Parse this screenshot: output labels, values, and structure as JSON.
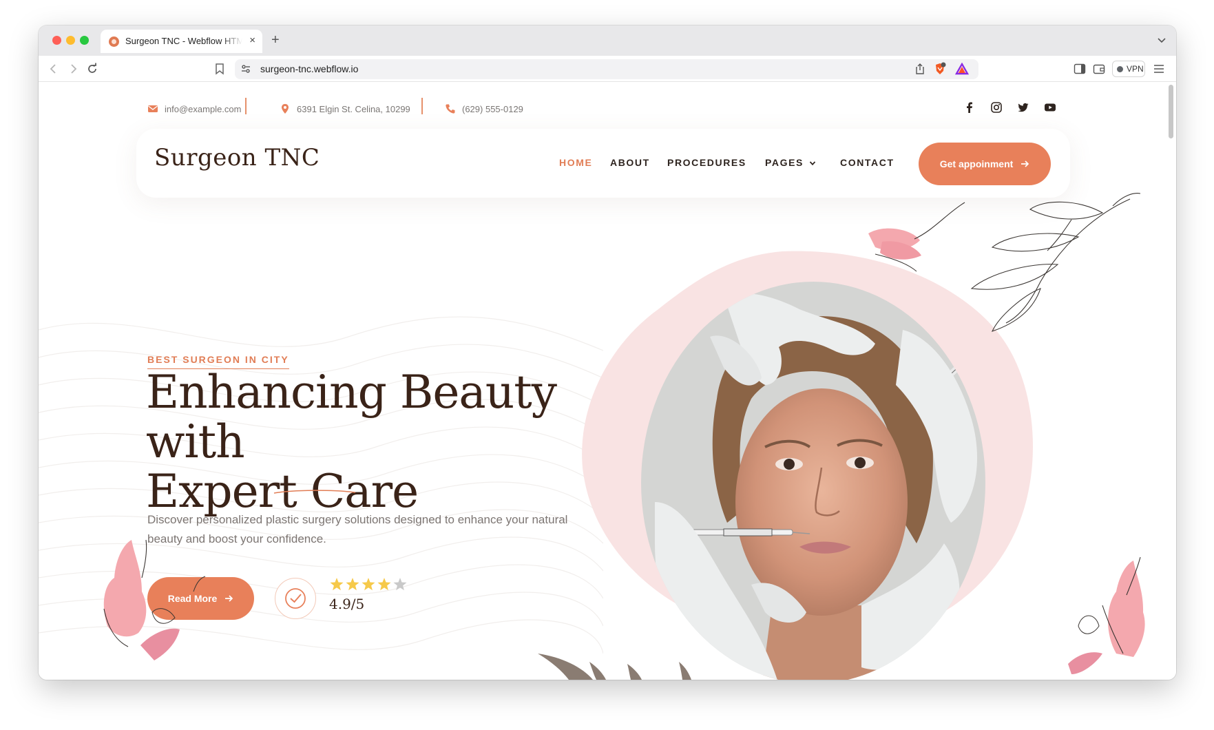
{
  "browser": {
    "tab_title": "Surgeon TNC - Webflow HTML",
    "url": "surgeon-tnc.webflow.io",
    "vpn_label": "VPN",
    "new_tab": "+",
    "tab_close": "×"
  },
  "topbar": {
    "email": "info@example.com",
    "address": "6391 Elgin St. Celina, 10299",
    "phone": "(629) 555-0129",
    "social": [
      "facebook-icon",
      "instagram-icon",
      "twitter-icon",
      "youtube-icon"
    ]
  },
  "nav": {
    "logo": "Surgeon TNC",
    "items": [
      {
        "label": "HOME",
        "active": true
      },
      {
        "label": "ABOUT"
      },
      {
        "label": "PROCEDURES"
      },
      {
        "label": "PAGES",
        "has_dropdown": true
      },
      {
        "label": "CONTACT"
      }
    ],
    "cta": "Get appoinment"
  },
  "hero": {
    "eyebrow": "BEST SURGEON IN CITY",
    "title_line1": "Enhancing Beauty with",
    "title_line2": "Expert Care",
    "description": "Discover personalized plastic surgery solutions designed to enhance your natural beauty and boost your confidence.",
    "read_more": "Read More",
    "rating": "4.9/5",
    "rating_stars": 4
  },
  "colors": {
    "accent": "#e8805a",
    "dark_text": "#3a2318",
    "blob_pink": "#f9e3e3"
  }
}
